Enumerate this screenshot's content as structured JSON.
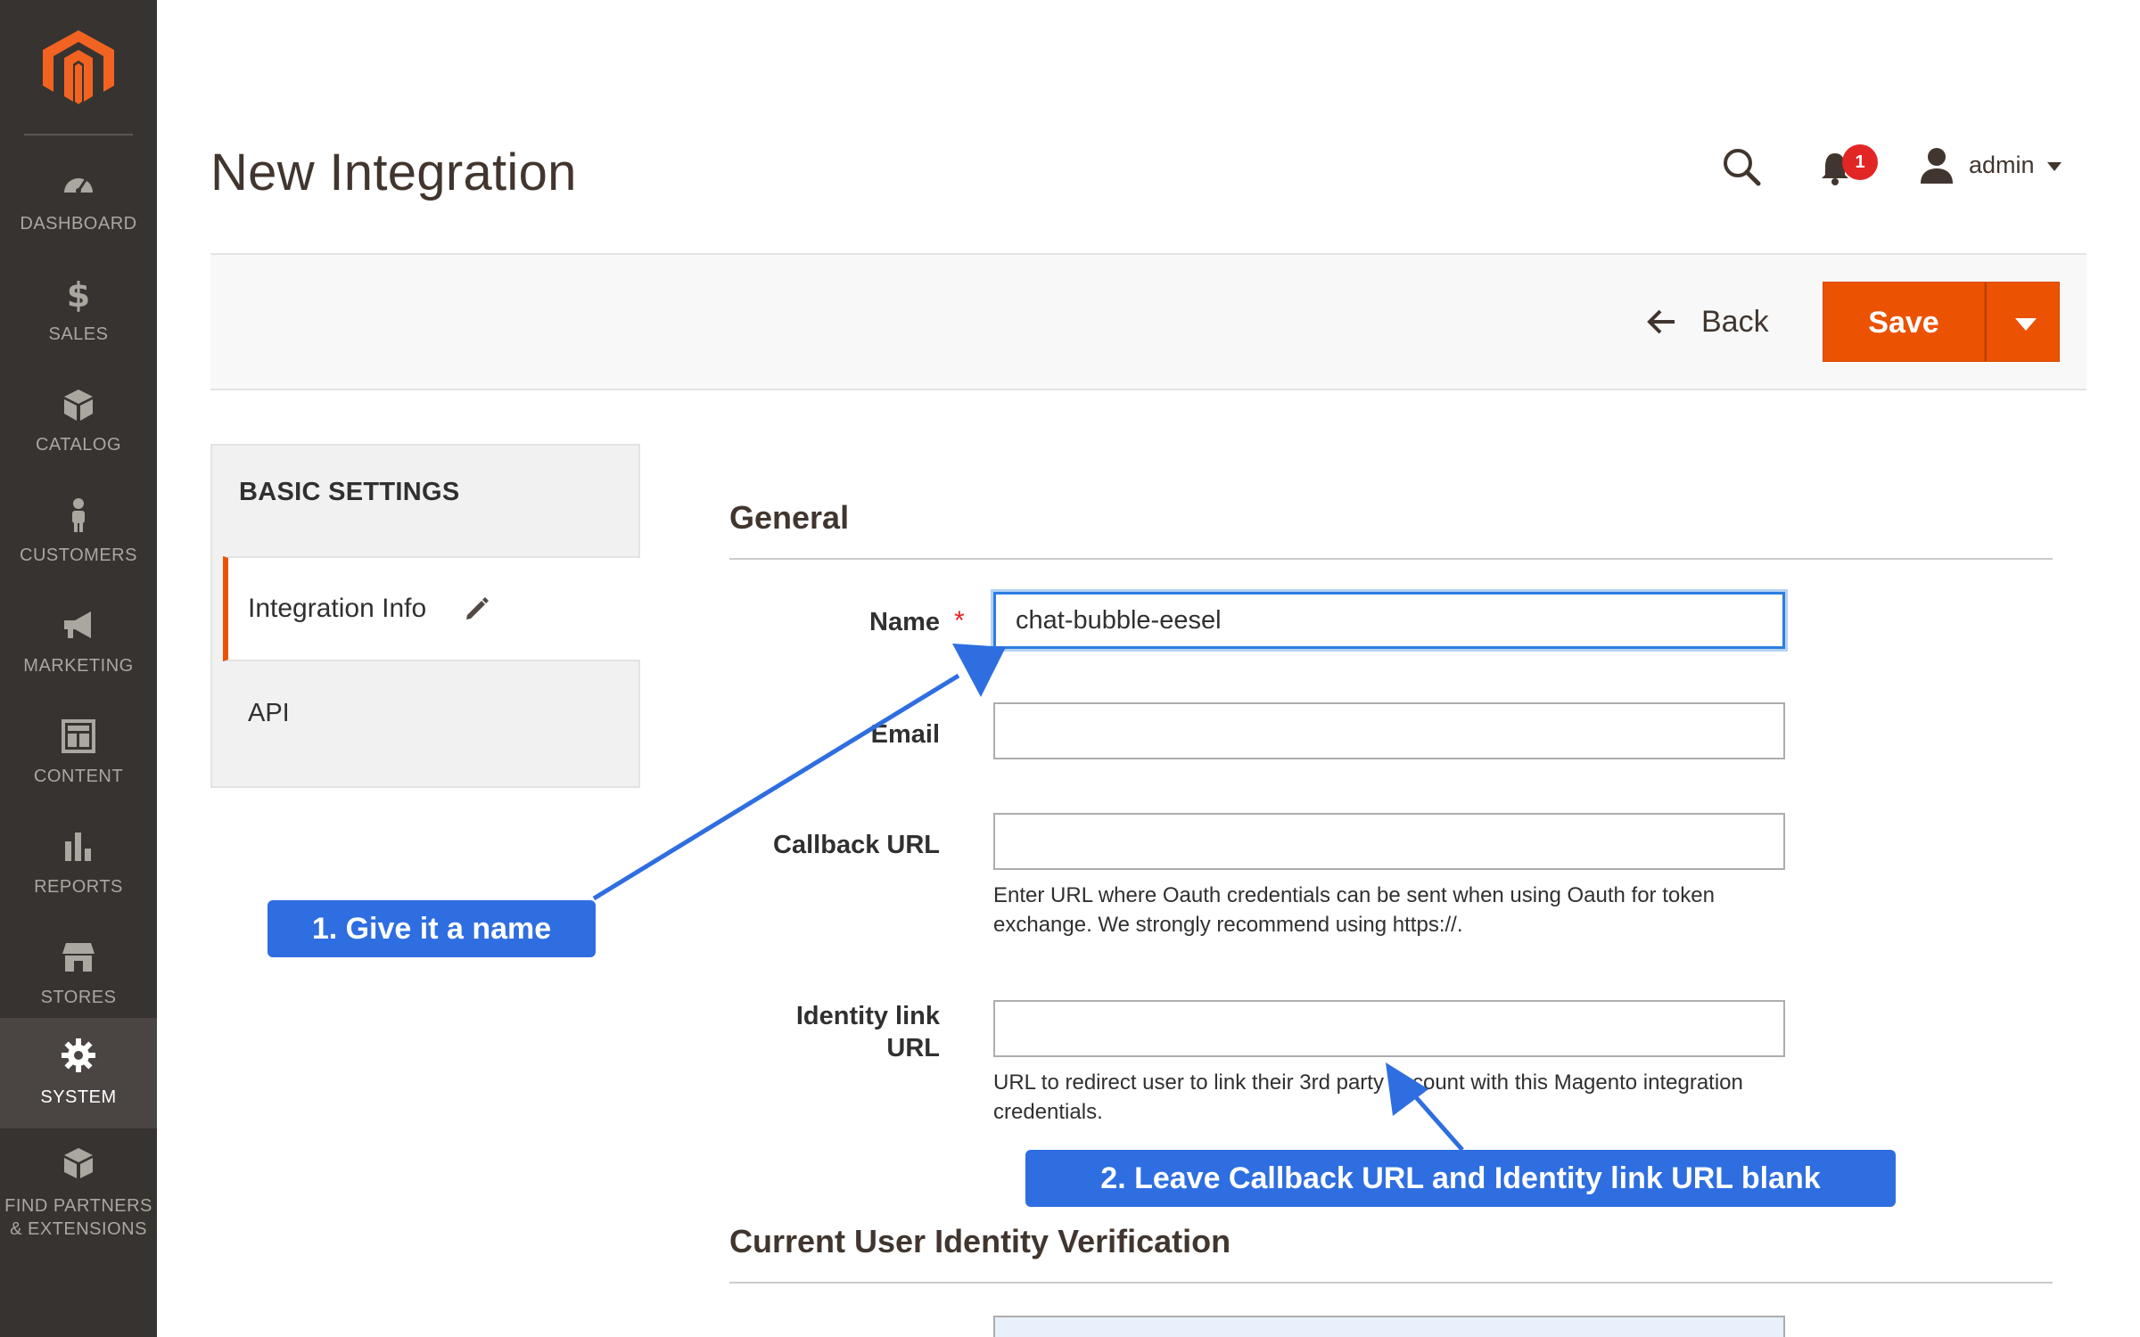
{
  "sidebar": {
    "items": [
      {
        "label": "DASHBOARD",
        "icon": "dashboard-icon"
      },
      {
        "label": "SALES",
        "icon": "dollar-icon"
      },
      {
        "label": "CATALOG",
        "icon": "box-icon"
      },
      {
        "label": "CUSTOMERS",
        "icon": "person-icon"
      },
      {
        "label": "MARKETING",
        "icon": "megaphone-icon"
      },
      {
        "label": "CONTENT",
        "icon": "layout-icon"
      },
      {
        "label": "REPORTS",
        "icon": "bar-chart-icon"
      },
      {
        "label": "STORES",
        "icon": "storefront-icon"
      },
      {
        "label": "SYSTEM",
        "icon": "gear-icon",
        "active": true
      },
      {
        "label_line1": "FIND PARTNERS",
        "label_line2": "& EXTENSIONS",
        "icon": "extensions-icon"
      }
    ]
  },
  "header": {
    "title": "New Integration",
    "notification_count": "1",
    "username": "admin"
  },
  "actions": {
    "back_label": "Back",
    "save_label": "Save"
  },
  "tabs": {
    "heading": "BASIC SETTINGS",
    "items": [
      {
        "label": "Integration Info",
        "active": true
      },
      {
        "label": "API"
      }
    ]
  },
  "form": {
    "section_general": "General",
    "name_label": "Name",
    "name_value": "chat-bubble-eesel",
    "email_label": "Email",
    "email_value": "",
    "callback_label": "Callback URL",
    "callback_value": "",
    "callback_note": "Enter URL where Oauth credentials can be sent when using Oauth for token exchange. We strongly recommend using https://.",
    "identity_label_line1": "Identity link",
    "identity_label_line2": "URL",
    "identity_value": "",
    "identity_note": "URL to redirect user to link their 3rd party account with this Magento integration credentials.",
    "section_verification": "Current User Identity Verification"
  },
  "annotations": {
    "callout_1": "1. Give it a name",
    "callout_2": "2. Leave Callback URL and Identity link URL blank",
    "color": "#2e6ee0"
  },
  "colors": {
    "sidebar_bg": "#373330",
    "accent": "#eb5202",
    "focus": "#2d7de0",
    "badge": "#e22626"
  }
}
